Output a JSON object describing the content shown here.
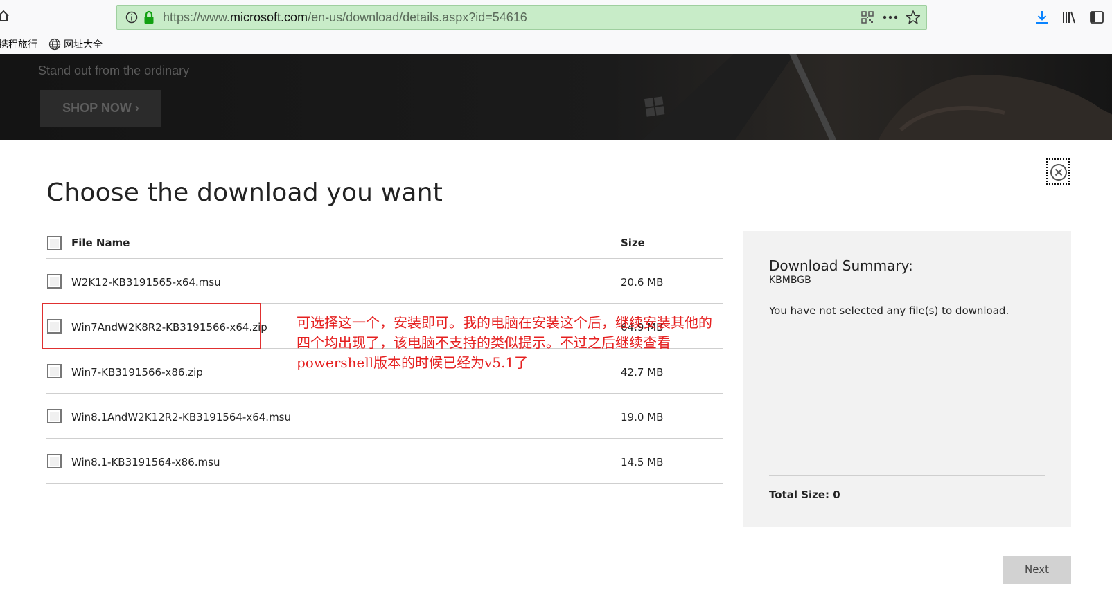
{
  "browser": {
    "url_prefix": "https://www.",
    "url_domain": "microsoft.com",
    "url_path": "/en-us/download/details.aspx?id=54616",
    "bookmarks": [
      "携程旅行",
      "网址大全"
    ]
  },
  "hero": {
    "tagline": "Stand out from the ordinary",
    "shop_label": "SHOP NOW ›"
  },
  "dialog": {
    "title": "Choose the download you want",
    "header": {
      "name": "File Name",
      "size": "Size"
    },
    "files": [
      {
        "name": "W2K12-KB3191565-x64.msu",
        "size": "20.6 MB",
        "checked": false
      },
      {
        "name": "Win7AndW2K8R2-KB3191566-x64.zip",
        "size": "64.9 MB",
        "checked": false
      },
      {
        "name": "Win7-KB3191566-x86.zip",
        "size": "42.7 MB",
        "checked": false
      },
      {
        "name": "Win8.1AndW2K12R2-KB3191564-x64.msu",
        "size": "19.0 MB",
        "checked": false
      },
      {
        "name": "Win8.1-KB3191564-x86.msu",
        "size": "14.5 MB",
        "checked": false
      }
    ],
    "annotation": "可选择这一个，安装即可。我的电脑在安装这个后，继续安装其他的四个均出现了，该电脑不支持的类似提示。不过之后继续查看powershell版本的时候已经为v5.1了",
    "summary": {
      "title": "Download Summary:",
      "code": "KBMBGB",
      "message": "You have not selected any file(s) to download.",
      "total": "Total Size: 0"
    },
    "next_label": "Next"
  },
  "colors": {
    "annotation": "#e52020",
    "url_bar": "#c8ecc8",
    "summary_bg": "#f2f2f2",
    "next_bg": "#d2d2d2"
  }
}
